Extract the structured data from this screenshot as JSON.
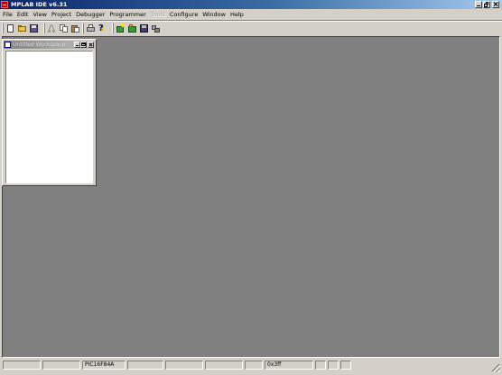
{
  "app": {
    "title": "MPLAB IDE v6.31"
  },
  "menu": {
    "items": [
      {
        "label": "File",
        "enabled": true
      },
      {
        "label": "Edit",
        "enabled": true
      },
      {
        "label": "View",
        "enabled": true
      },
      {
        "label": "Project",
        "enabled": true
      },
      {
        "label": "Debugger",
        "enabled": true
      },
      {
        "label": "Programmer",
        "enabled": true
      },
      {
        "label": "Tools",
        "enabled": false
      },
      {
        "label": "Configure",
        "enabled": true
      },
      {
        "label": "Window",
        "enabled": true
      },
      {
        "label": "Help",
        "enabled": true
      }
    ]
  },
  "toolbar": {
    "icons": [
      "new-file-icon",
      "open-file-icon",
      "save-icon",
      "cut-icon",
      "copy-icon",
      "paste-icon",
      "print-icon",
      "help-icon",
      "new-project-icon",
      "open-project-icon",
      "save-project-icon",
      "build-icon"
    ]
  },
  "workspace": {
    "title": "Untitled Workspace"
  },
  "statusbar": {
    "cells": [
      "",
      "",
      "PIC16F84A",
      "",
      "",
      "",
      "",
      "0x3ff",
      "",
      "",
      ""
    ]
  },
  "colors": {
    "titlebar_start": "#0a246a",
    "titlebar_end": "#a6caf0",
    "mdi_background": "#808080",
    "chrome": "#d4d0c8"
  }
}
